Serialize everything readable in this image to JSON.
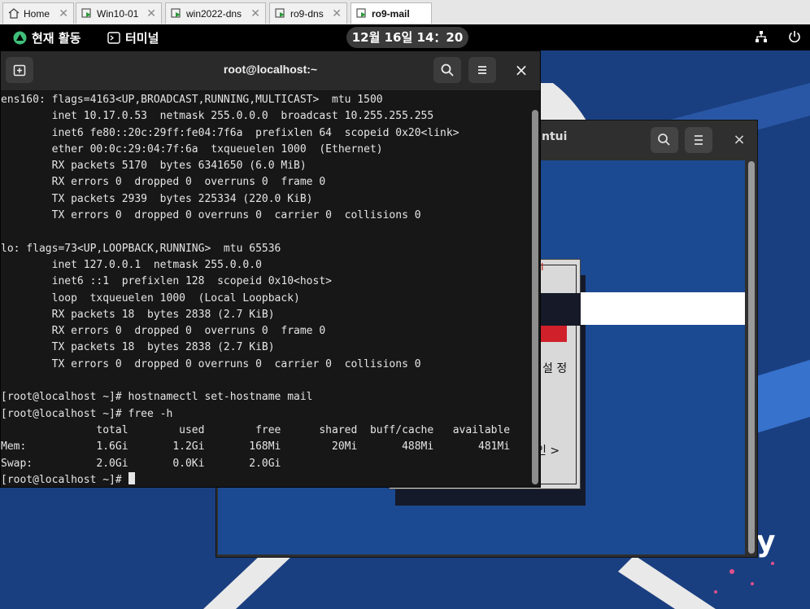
{
  "vm_tabs": [
    {
      "label": "Home",
      "icon": "home-icon",
      "active": false
    },
    {
      "label": "Win10-01",
      "icon": "vm-icon",
      "active": false
    },
    {
      "label": "win2022-dns",
      "icon": "vm-icon",
      "active": false
    },
    {
      "label": "ro9-dns",
      "icon": "vm-icon",
      "active": false
    },
    {
      "label": "ro9-mail",
      "icon": "vm-icon",
      "active": true
    }
  ],
  "tab_close_glyph": "✕",
  "topbar": {
    "activities": "현재 활동",
    "app_name": "터미널",
    "clock": "12월 16일 14：20"
  },
  "background_window": {
    "title_fragment": "ntui",
    "text_fragments": [
      "I",
      "설 정",
      "인 >"
    ],
    "close_glyph": "×"
  },
  "terminal": {
    "title": "root@localhost:~",
    "close_glyph": "×",
    "lines": [
      "ens160: flags=4163<UP,BROADCAST,RUNNING,MULTICAST>  mtu 1500",
      "        inet 10.17.0.53  netmask 255.0.0.0  broadcast 10.255.255.255",
      "        inet6 fe80::20c:29ff:fe04:7f6a  prefixlen 64  scopeid 0x20<link>",
      "        ether 00:0c:29:04:7f:6a  txqueuelen 1000  (Ethernet)",
      "        RX packets 5170  bytes 6341650 (6.0 MiB)",
      "        RX errors 0  dropped 0  overruns 0  frame 0",
      "        TX packets 2939  bytes 225334 (220.0 KiB)",
      "        TX errors 0  dropped 0 overruns 0  carrier 0  collisions 0",
      "",
      "lo: flags=73<UP,LOOPBACK,RUNNING>  mtu 65536",
      "        inet 127.0.0.1  netmask 255.0.0.0",
      "        inet6 ::1  prefixlen 128  scopeid 0x10<host>",
      "        loop  txqueuelen 1000  (Local Loopback)",
      "        RX packets 18  bytes 2838 (2.7 KiB)",
      "        RX errors 0  dropped 0  overruns 0  frame 0",
      "        TX packets 18  bytes 2838 (2.7 KiB)",
      "        TX errors 0  dropped 0 overruns 0  carrier 0  collisions 0",
      "",
      "[root@localhost ~]# hostnamectl set-hostname mail",
      "[root@localhost ~]# free -h",
      "               total        used        free      shared  buff/cache   available",
      "Mem:           1.6Gi       1.2Gi       168Mi        20Mi       488Mi       481Mi",
      "Swap:          2.0Gi       0.0Ki       2.0Gi",
      "[root@localhost ~]# "
    ]
  },
  "desktop_letter": "y",
  "colors": {
    "desktop": "#1a3f80",
    "terminal_bg": "#171717",
    "terminal_fg": "#e5e5e5",
    "accent_red": "#d0202a"
  }
}
